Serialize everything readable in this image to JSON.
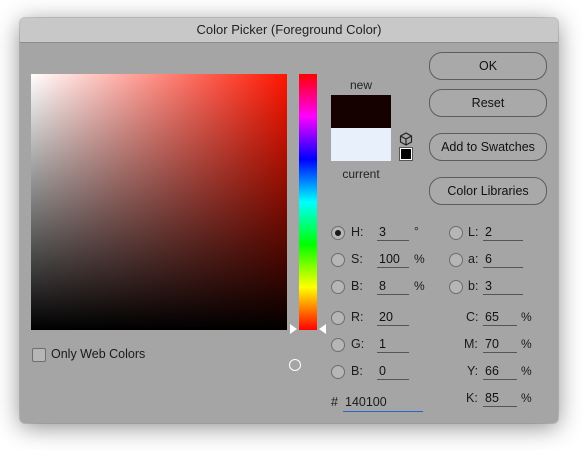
{
  "window": {
    "title": "Color Picker (Foreground Color)"
  },
  "preview": {
    "new_label": "new",
    "current_label": "current",
    "new_color": "#140100",
    "current_color": "#e8f0fc"
  },
  "buttons": {
    "ok": "OK",
    "reset": "Reset",
    "add_swatches": "Add to Swatches",
    "libraries": "Color Libraries"
  },
  "fields": {
    "H": {
      "label": "H:",
      "value": "3",
      "unit": "°"
    },
    "S": {
      "label": "S:",
      "value": "100",
      "unit": "%"
    },
    "Bv": {
      "label": "B:",
      "value": "8",
      "unit": "%"
    },
    "R": {
      "label": "R:",
      "value": "20"
    },
    "G": {
      "label": "G:",
      "value": "1"
    },
    "B": {
      "label": "B:",
      "value": "0"
    },
    "L": {
      "label": "L:",
      "value": "2"
    },
    "a": {
      "label": "a:",
      "value": "6"
    },
    "b": {
      "label": "b:",
      "value": "3"
    },
    "C": {
      "label": "C:",
      "value": "65",
      "unit": "%"
    },
    "M": {
      "label": "M:",
      "value": "70",
      "unit": "%"
    },
    "Y": {
      "label": "Y:",
      "value": "66",
      "unit": "%"
    },
    "K": {
      "label": "K:",
      "value": "85",
      "unit": "%"
    }
  },
  "hex": {
    "label": "#",
    "value": "140100"
  },
  "web_colors": {
    "label": "Only Web Colors",
    "checked": false
  },
  "selected_mode": "H"
}
